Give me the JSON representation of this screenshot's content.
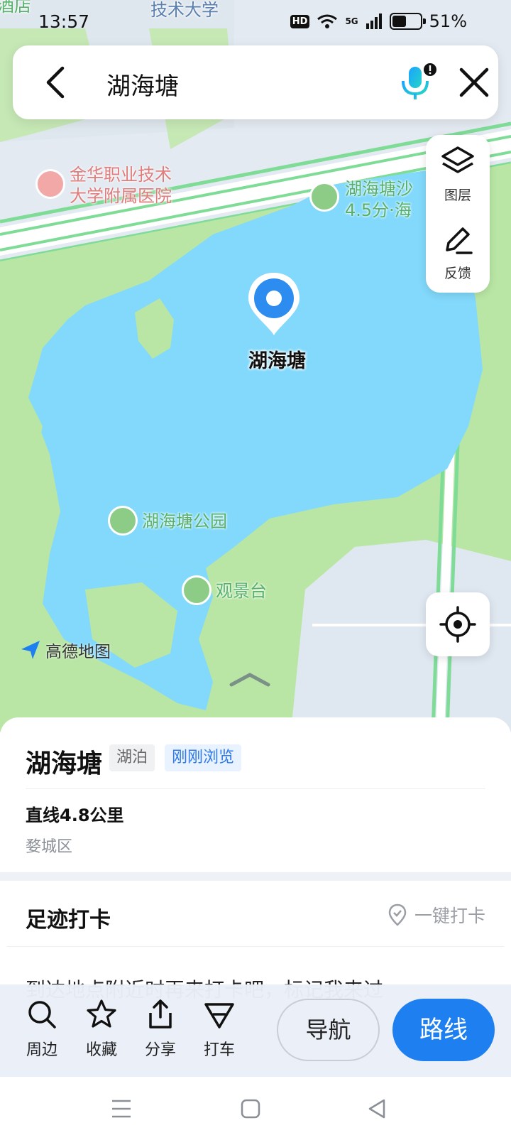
{
  "status_bar": {
    "time": "13:57",
    "hd": "HD",
    "network": "5G",
    "battery": "51%",
    "battery_level": 0.51
  },
  "search": {
    "query": "湖海塘"
  },
  "tools": {
    "layers_label": "图层",
    "feedback_label": "反馈"
  },
  "map": {
    "top_label_1": "酒店",
    "top_label_2": "技术大学",
    "hospital_name_line1": "金华职业技术",
    "hospital_name_line2": "大学附属医院",
    "beach_line1": "湖海塘沙",
    "beach_line2": "4.5分·海",
    "marker_name": "湖海塘",
    "park_name": "湖海塘公园",
    "viewpoint_name": "观景台",
    "logo_text": "高德地图"
  },
  "place": {
    "name": "湖海塘",
    "category_tag": "湖泊",
    "recent_tag": "刚刚浏览",
    "distance": "直线4.8公里",
    "district": "婺城区"
  },
  "checkin": {
    "title": "足迹打卡",
    "button": "一键打卡",
    "hint": "到达地点附近时再来打卡吧，标记我来过"
  },
  "actions": {
    "nearby": "周边",
    "favorite": "收藏",
    "share": "分享",
    "taxi": "打车",
    "navigate": "导航",
    "route": "路线"
  },
  "colors": {
    "accent": "#1e7ff0",
    "lake": "#82d9fb",
    "park": "#b9e6a5"
  }
}
